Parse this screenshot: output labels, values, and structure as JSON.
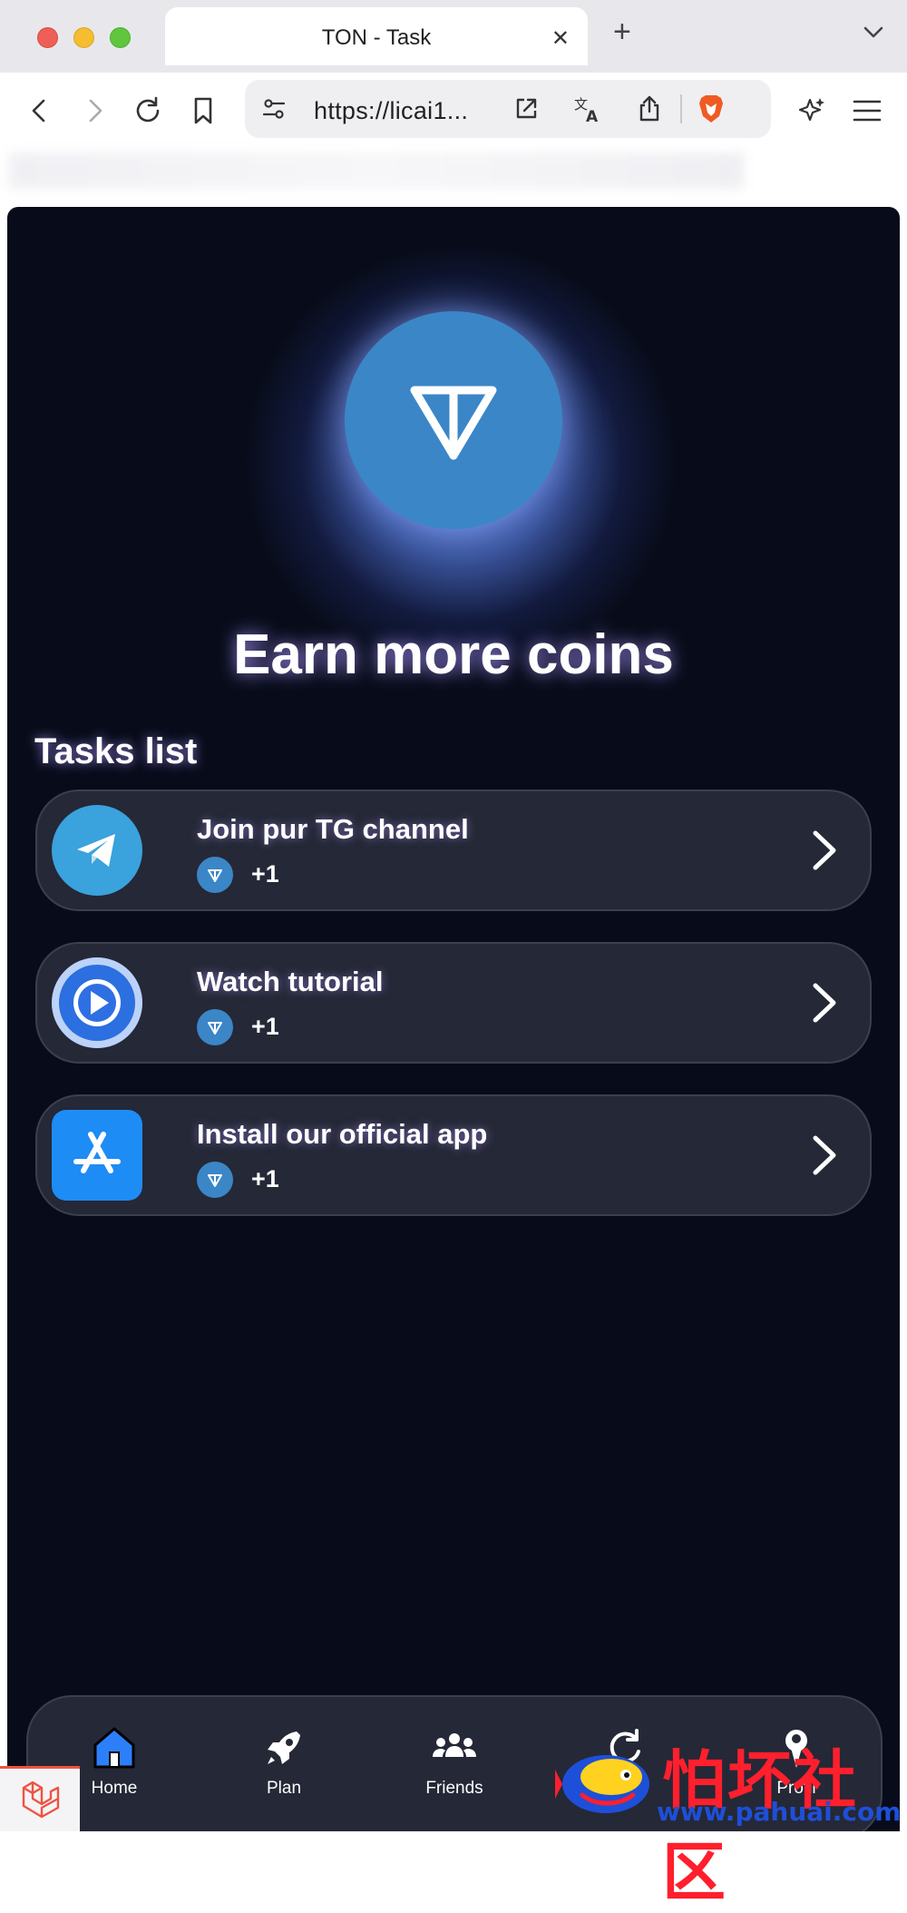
{
  "browser": {
    "tab_title": "TON - Task",
    "tab_close": "✕",
    "new_tab": "+",
    "url": "https://licai1..."
  },
  "app": {
    "headline": "Earn more coins",
    "section_title": "Tasks list",
    "tasks": [
      {
        "title": "Join pur TG channel",
        "reward": "+1",
        "icon": "telegram-icon"
      },
      {
        "title": "Watch tutorial",
        "reward": "+1",
        "icon": "play-icon"
      },
      {
        "title": "Install our official app",
        "reward": "+1",
        "icon": "app-store-icon"
      }
    ],
    "nav": [
      {
        "label": "Home",
        "icon": "home-icon",
        "active": true
      },
      {
        "label": "Plan",
        "icon": "rocket-icon"
      },
      {
        "label": "Friends",
        "icon": "friends-icon"
      },
      {
        "label": "",
        "icon": "earn-icon"
      },
      {
        "label": "Profil",
        "icon": "profile-icon"
      }
    ]
  },
  "watermark": {
    "cn_text": "怕坏社区",
    "url": "www.pahuai.com"
  },
  "colors": {
    "app_bg": "#080c1a",
    "card_bg": "#252836",
    "ton_blue": "#3b86c7"
  }
}
